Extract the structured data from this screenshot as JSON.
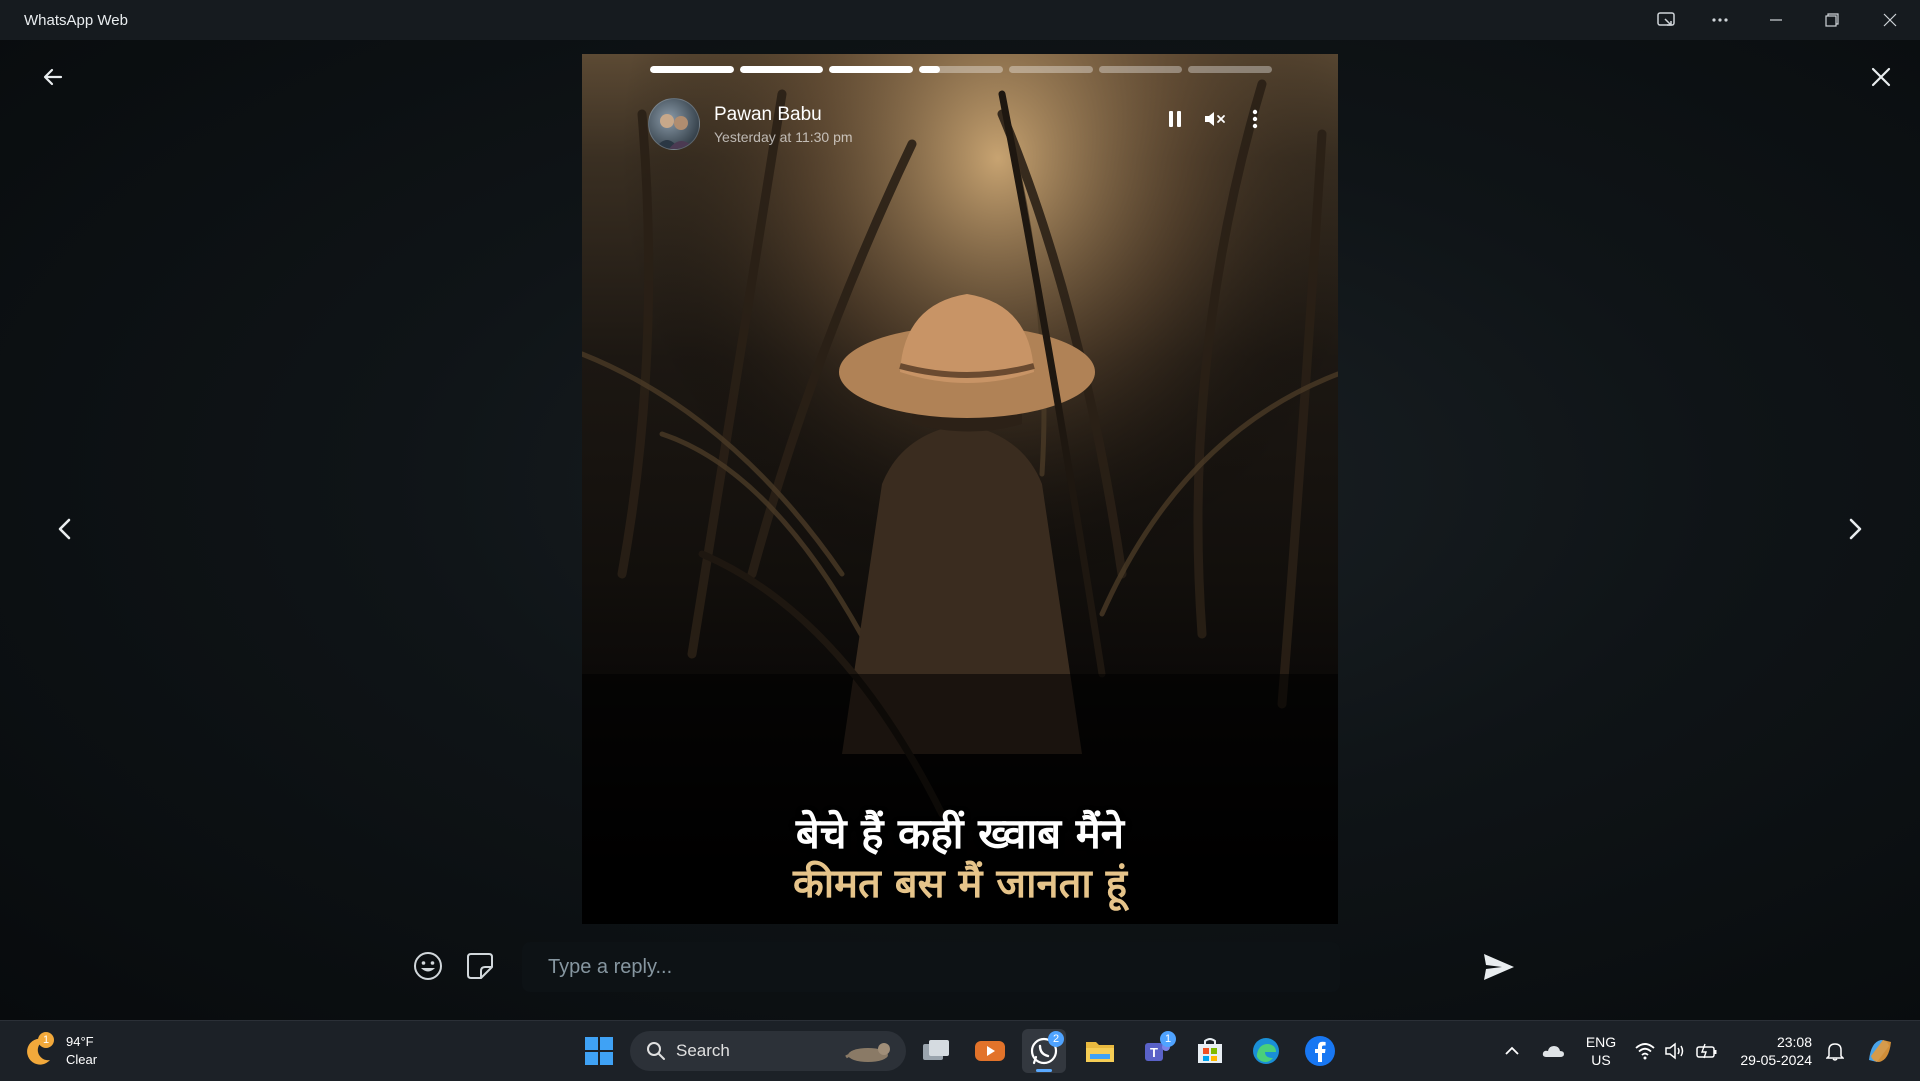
{
  "window": {
    "title": "WhatsApp Web"
  },
  "story": {
    "author": "Pawan Babu",
    "timestamp": "Yesterday at 11:30 pm",
    "progress": [
      1,
      1,
      1,
      0.25,
      0,
      0,
      0
    ],
    "caption_line1": "बेचे हैं कहीं ख्वाब मैंने",
    "caption_line2": "कीमत बस मैं जानता हूं"
  },
  "reply": {
    "placeholder": "Type a reply..."
  },
  "taskbar": {
    "weather_temp": "94°F",
    "weather_cond": "Clear",
    "weather_badge": "1",
    "search_label": "Search",
    "whatsapp_badge": "2",
    "teams_badge": "1",
    "lang_line1": "ENG",
    "lang_line2": "US",
    "time": "23:08",
    "date": "29-05-2024"
  },
  "colors": {
    "accent": "#4fa3ff",
    "caption_gold": "#e6c48a",
    "titlebar": "#161b1f",
    "taskbar": "#1c2127"
  }
}
